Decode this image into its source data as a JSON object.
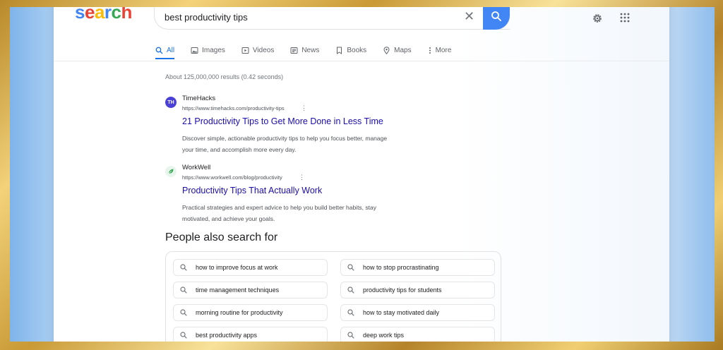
{
  "logo": [
    "s",
    "e",
    "a",
    "r",
    "c",
    "h"
  ],
  "search": {
    "query": "best productivity tips"
  },
  "tabs": [
    {
      "label": "All",
      "icon": "search-icon"
    },
    {
      "label": "Images",
      "icon": "image-icon"
    },
    {
      "label": "Videos",
      "icon": "video-icon"
    },
    {
      "label": "News",
      "icon": "news-icon"
    },
    {
      "label": "Books",
      "icon": "bookmark-icon"
    },
    {
      "label": "Maps",
      "icon": "map-pin-icon"
    },
    {
      "label": "More",
      "icon": "more-vertical-icon"
    }
  ],
  "stats": "About 125,000,000 results (0.42 seconds)",
  "results": [
    {
      "favicon_text": "TH",
      "site": "TimeHacks",
      "url": "https://www.timehacks.com/productivity-tips",
      "title": "21 Productivity Tips to Get More Done in Less Time",
      "snippet": "Discover simple, actionable productivity tips to help you focus better, manage your time, and accomplish more every day."
    },
    {
      "favicon_text": "",
      "site": "WorkWell",
      "url": "https://www.workwell.com/blog/productivity",
      "title": "Productivity Tips That Actually Work",
      "snippet": "Practical strategies and expert advice to help you build better habits, stay motivated, and achieve your goals."
    }
  ],
  "people_also_search": {
    "heading": "People also search for",
    "items": [
      "how to improve focus at work",
      "how to stop procrastinating",
      "time management techniques",
      "productivity tips for students",
      "morning routine for productivity",
      "how to stay motivated daily",
      "best productivity apps",
      "deep work tips"
    ]
  },
  "colors": {
    "accent": "#1a73e8",
    "link": "#1a0dab",
    "search_button": "#4285f4",
    "timehacks_favicon": "#4a3fd6",
    "workwell_favicon": "#34a853"
  }
}
